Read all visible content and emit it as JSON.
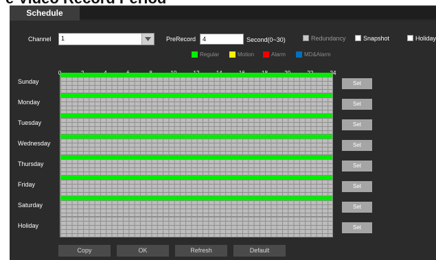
{
  "page": {
    "heading": "e Video Record Period"
  },
  "tabs": [
    {
      "label": "Schedule"
    }
  ],
  "form": {
    "channel_label": "Channel",
    "channel_value": "1",
    "prerecord_label": "PreRecord",
    "prerecord_value": "4",
    "prerecord_unit": "Second(0~30)",
    "options": [
      {
        "label": "Redundancy",
        "checked": false,
        "disabled": true
      },
      {
        "label": "Snapshot",
        "checked": false,
        "disabled": false
      },
      {
        "label": "Holiday",
        "checked": false,
        "disabled": false
      }
    ]
  },
  "legend": [
    {
      "label": "Regular",
      "color": "#00ee00"
    },
    {
      "label": "Motion",
      "color": "#ffee00"
    },
    {
      "label": "Alarm",
      "color": "#ee0000"
    },
    {
      "label": "MD&Alarm",
      "color": "#0070c0"
    }
  ],
  "timeline": {
    "hours": [
      "0",
      "2",
      "4",
      "6",
      "8",
      "10",
      "12",
      "14",
      "16",
      "18",
      "20",
      "22",
      "24"
    ],
    "days": [
      {
        "label": "Sunday",
        "regular": true,
        "set_label": "Set"
      },
      {
        "label": "Monday",
        "regular": true,
        "set_label": "Set"
      },
      {
        "label": "Tuesday",
        "regular": true,
        "set_label": "Set"
      },
      {
        "label": "Wednesday",
        "regular": true,
        "set_label": "Set"
      },
      {
        "label": "Thursday",
        "regular": true,
        "set_label": "Set"
      },
      {
        "label": "Friday",
        "regular": true,
        "set_label": "Set"
      },
      {
        "label": "Saturday",
        "regular": true,
        "set_label": "Set"
      },
      {
        "label": "Holiday",
        "regular": false,
        "set_label": "Set"
      }
    ]
  },
  "buttons": {
    "copy": "Copy",
    "ok": "OK",
    "refresh": "Refresh",
    "default": "Default"
  }
}
